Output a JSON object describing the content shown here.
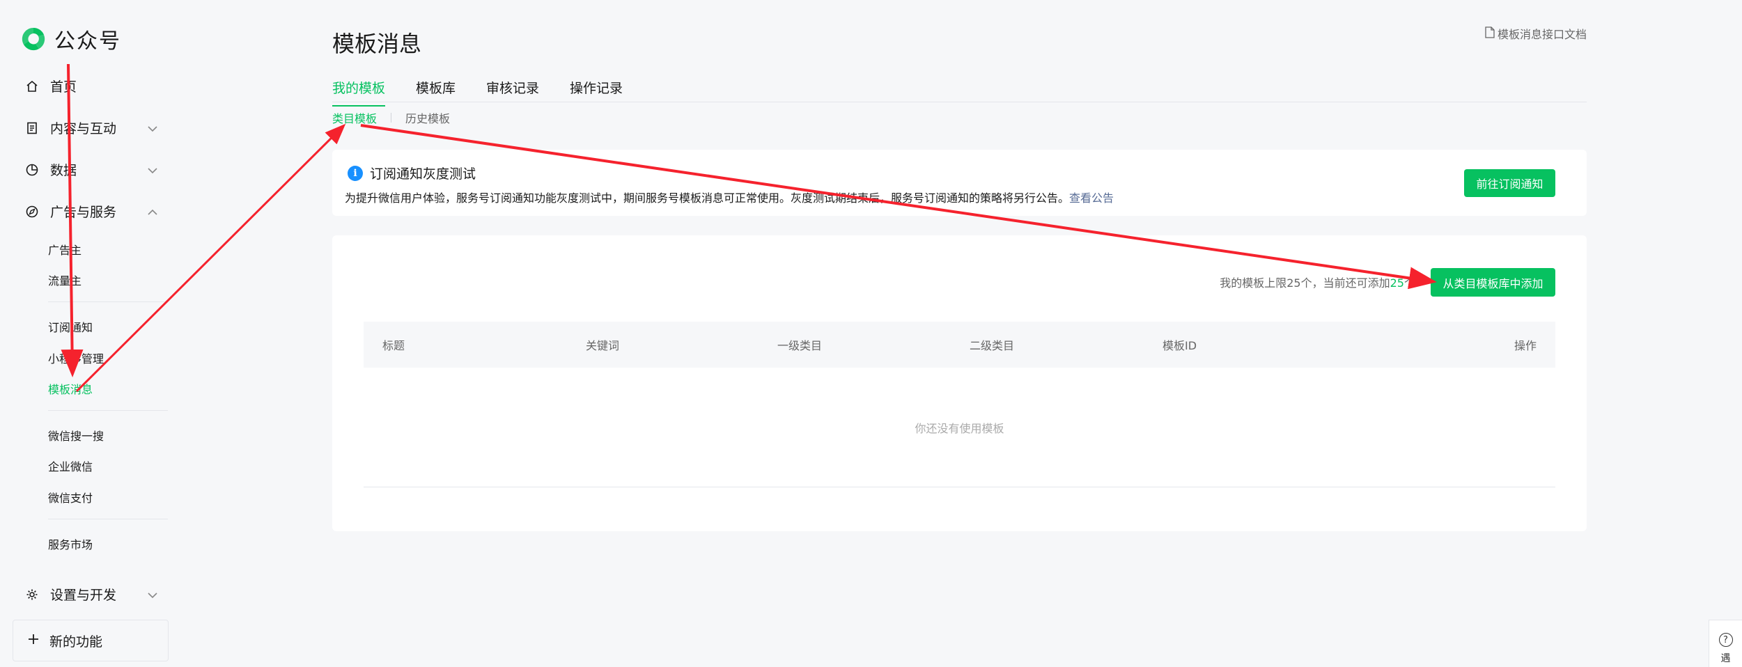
{
  "app": {
    "name": "公众号",
    "brand_color": "#07c160"
  },
  "sidebar": {
    "top_items": [
      {
        "label": "首页",
        "icon": "home-icon"
      },
      {
        "label": "内容与互动",
        "icon": "document-icon"
      },
      {
        "label": "数据",
        "icon": "pie-chart-icon"
      },
      {
        "label": "广告与服务",
        "icon": "compass-icon"
      },
      {
        "label": "设置与开发",
        "icon": "gear-icon"
      }
    ],
    "sub_items": [
      {
        "label": "广告主"
      },
      {
        "label": "流量主"
      },
      {
        "label": "订阅通知"
      },
      {
        "label": "小程序管理"
      },
      {
        "label": "模板消息"
      },
      {
        "label": "微信搜一搜"
      },
      {
        "label": "企业微信"
      },
      {
        "label": "微信支付"
      },
      {
        "label": "服务市场"
      }
    ],
    "new_feature": "新的功能"
  },
  "header": {
    "title": "模板消息",
    "doc_link": "模板消息接口文档"
  },
  "tabs": [
    {
      "label": "我的模板"
    },
    {
      "label": "模板库"
    },
    {
      "label": "审核记录"
    },
    {
      "label": "操作记录"
    }
  ],
  "subtabs": [
    {
      "label": "类目模板"
    },
    {
      "label": "历史模板"
    }
  ],
  "notice": {
    "title": "订阅通知灰度测试",
    "desc": "为提升微信用户体验，服务号订阅通知功能灰度测试中，期间服务号模板消息可正常使用。灰度测试期结束后，服务号订阅通知的策略将另行公告。",
    "link": "查看公告",
    "button": "前往订阅通知"
  },
  "panel": {
    "limit_prefix": "我的模板上限25个，当前还可添加",
    "limit_remaining": "25",
    "limit_suffix": "个",
    "add_button": "从类目模板库中添加",
    "columns": [
      "标题",
      "关键词",
      "一级类目",
      "二级类目",
      "模板ID",
      "操作"
    ],
    "empty": "你还没有使用模板"
  },
  "help": {
    "label": "遇"
  }
}
